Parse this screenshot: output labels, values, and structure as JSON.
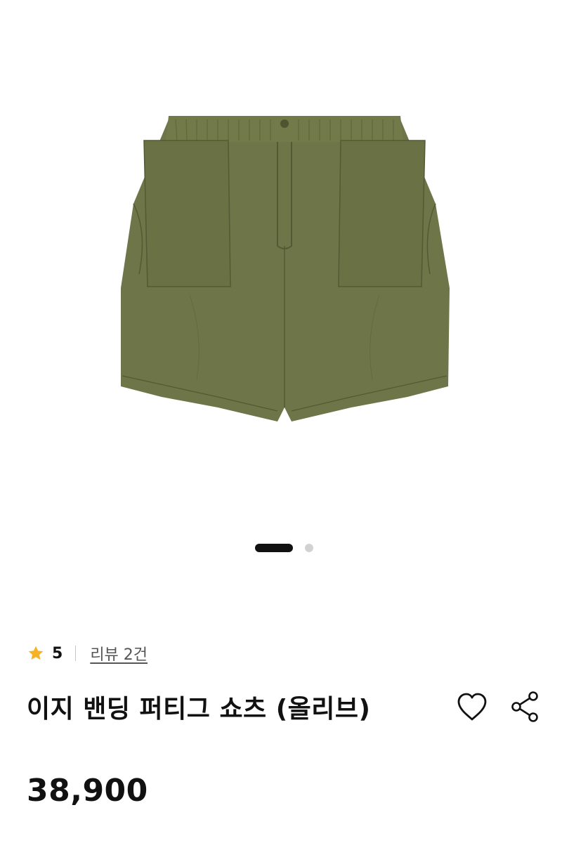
{
  "product": {
    "title": "이지 밴딩 퍼티그 쇼츠 (올리브)",
    "price": "38,900",
    "image_icon": "olive-shorts-image"
  },
  "rating": {
    "score": "5",
    "review_link": "리뷰 2건",
    "star_color": "#F5B324"
  },
  "gallery": {
    "current_page": 1,
    "total_pages": 2,
    "active_color": "#111111",
    "inactive_color": "#D2D2D2"
  },
  "actions": {
    "like_icon": "heart-icon",
    "share_icon": "share-icon"
  },
  "colors": {
    "olive": "#6E7548",
    "olive_dark": "#5C6339",
    "text": "#111111"
  }
}
